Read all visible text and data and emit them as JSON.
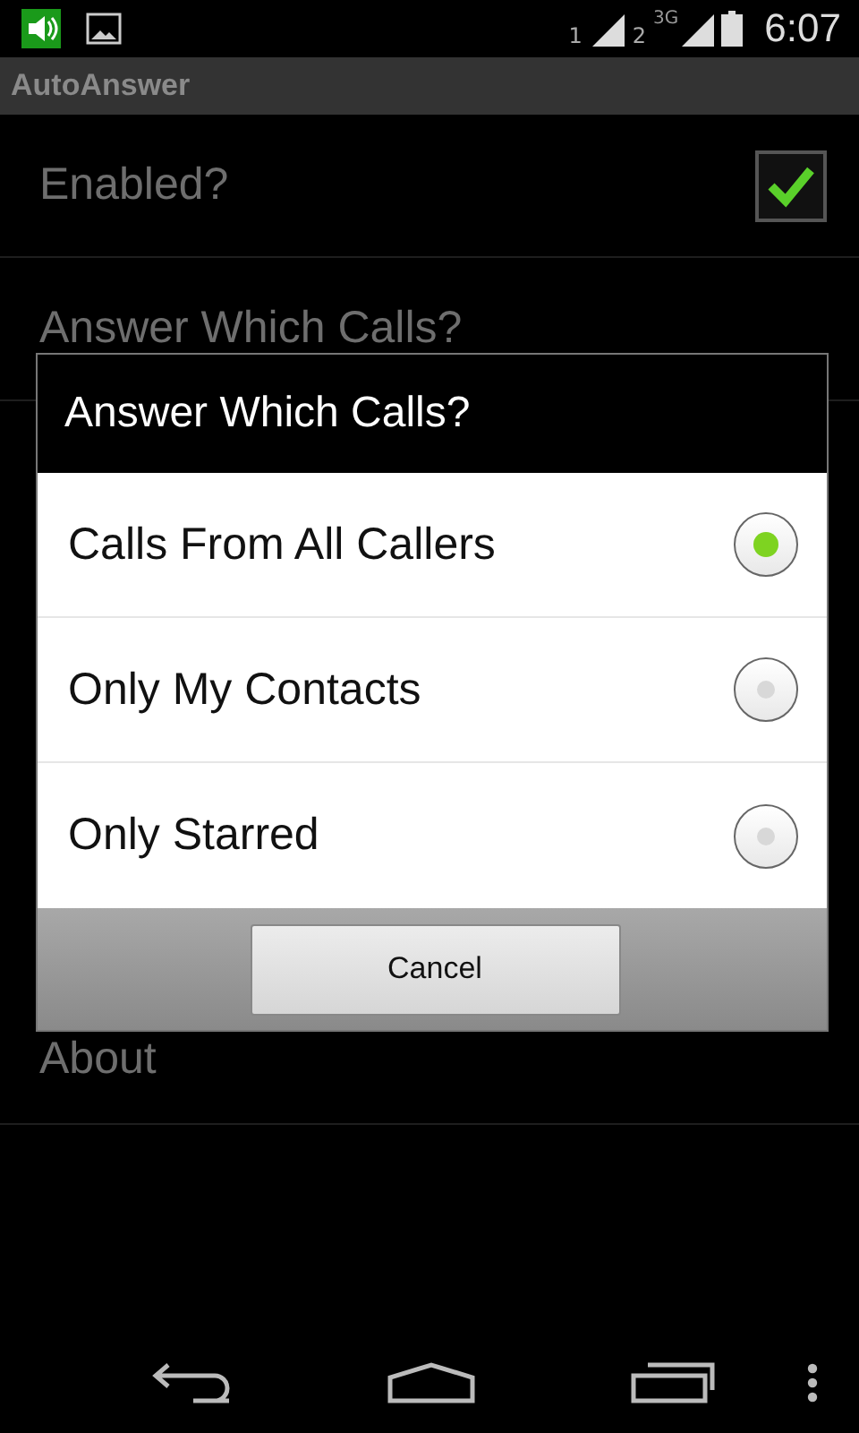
{
  "status_bar": {
    "sim_1": "1",
    "sim_2": "2",
    "network": "3G",
    "time": "6:07"
  },
  "action_bar": {
    "title": "AutoAnswer"
  },
  "settings": [
    {
      "label": "Enabled?",
      "kind": "checkbox",
      "checked": true
    },
    {
      "label": "Answer Which Calls?",
      "kind": "plain"
    },
    {
      "label": "About",
      "kind": "plain"
    }
  ],
  "dialog": {
    "title": "Answer Which Calls?",
    "options": [
      {
        "label": "Calls From All Callers",
        "selected": true
      },
      {
        "label": "Only My Contacts",
        "selected": false
      },
      {
        "label": "Only Starred",
        "selected": false
      }
    ],
    "button": "Cancel"
  }
}
